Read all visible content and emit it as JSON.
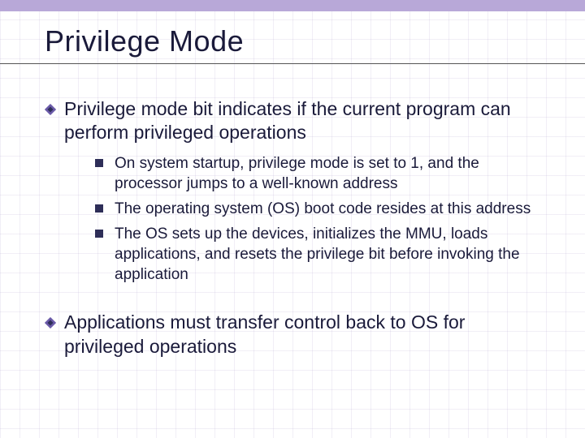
{
  "title": "Privilege Mode",
  "bullets": [
    {
      "text": "Privilege mode bit indicates if the current program can perform privileged operations",
      "sub": [
        "On system startup, privilege mode is set to 1, and the processor jumps to a well-known address",
        "The operating system (OS) boot code resides at this address",
        "The OS sets up the devices, initializes the MMU, loads applications, and resets the privilege bit before invoking the application"
      ]
    },
    {
      "text": "Applications must transfer control back to OS for privileged operations",
      "sub": []
    }
  ]
}
